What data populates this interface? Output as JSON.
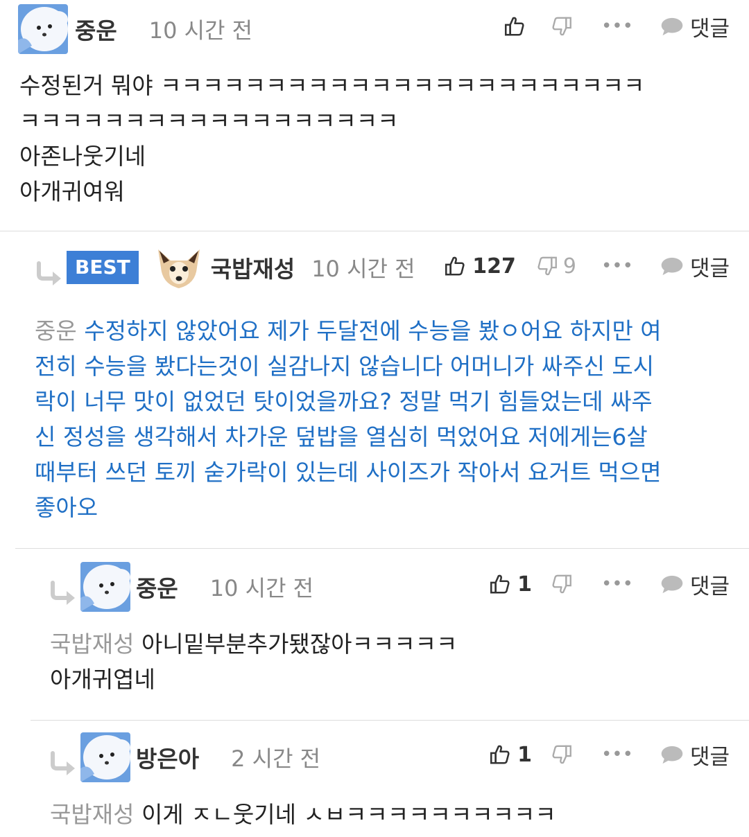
{
  "comments": [
    {
      "author": "중운",
      "time": "10 시간 전",
      "reply_label": "댓글",
      "body_lines": [
        "수정된거 뭐야 ㅋㅋㅋㅋㅋㅋㅋㅋㅋㅋㅋㅋㅋㅋㅋㅋㅋㅋㅋㅋㅋㅋㅋ",
        "ㅋㅋㅋㅋㅋㅋㅋㅋㅋㅋㅋㅋㅋㅋㅋㅋㅋㅋ",
        "아존나웃기네",
        "아개귀여워"
      ]
    },
    {
      "badge": "BEST",
      "author": "국밥재성",
      "time": "10 시간 전",
      "likes": "127",
      "dislikes": "9",
      "reply_label": "댓글",
      "mention": "중운",
      "body_first": " 수정하지 않았어요 제가 두달전에 수능을 봤ㅇ어요 하지만 여",
      "body_lines": [
        "전히 수능을 봤다는것이 실감나지 않습니다 어머니가 싸주신 도시",
        "락이 너무 맛이 없었던 탓이었을까요? 정말 먹기 힘들었는데 싸주",
        "신 정성을 생각해서 차가운 덮밥을 열심히 먹었어요 저에게는6살",
        "때부터 쓰던 토끼 숟가락이 있는데 사이즈가 작아서 요거트 먹으면",
        "좋아오"
      ]
    },
    {
      "author": "중운",
      "time": "10 시간 전",
      "likes": "1",
      "reply_label": "댓글",
      "mention": "국밥재성",
      "body_first": " 아니밑부분추가됐잖아ㅋㅋㅋㅋㅋ",
      "body_lines": [
        "아개귀엽네"
      ]
    },
    {
      "author": "방은아",
      "time": "2 시간 전",
      "likes": "1",
      "reply_label": "댓글",
      "mention": "국밥재성",
      "body_first": " 이게 ㅈㄴ웃기네 ㅅㅂㅋㅋㅋㅋㅋㅋㅋㅋㅋㅋ"
    }
  ],
  "icons": {
    "like": "thumbs-up-icon",
    "dislike": "thumbs-down-icon",
    "more": "ellipsis-icon",
    "reply": "speech-bubble-icon",
    "reply_arrow": "reply-arrow-icon",
    "avatar_seal": "seal-avatar",
    "avatar_dog": "dog-avatar"
  },
  "colors": {
    "accent_blue": "#1f6fc5",
    "best_badge": "#3d7fd6",
    "muted": "#999999"
  }
}
